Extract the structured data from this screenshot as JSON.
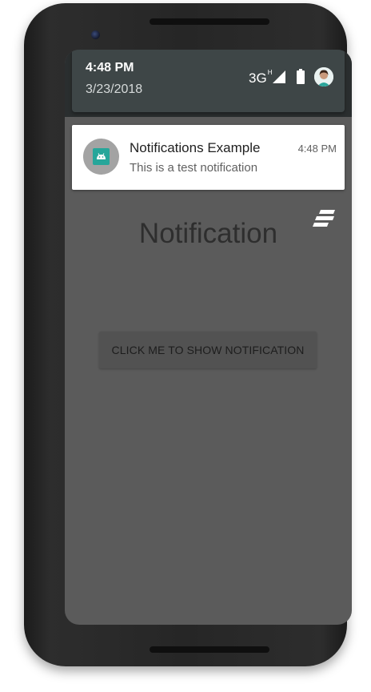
{
  "status_panel": {
    "time": "4:48 PM",
    "date": "3/23/2018",
    "network": "3G",
    "network_sub": "H",
    "icons": [
      "signal-icon",
      "battery-icon",
      "avatar"
    ]
  },
  "notification": {
    "title": "Notifications Example",
    "time": "4:48 PM",
    "text": "This is a test notification",
    "icon": "android-icon"
  },
  "app": {
    "title": "Notification",
    "button_label": "CLICK ME TO SHOW NOTIFICATION",
    "menu_icon": "stacked-bars-icon"
  },
  "colors": {
    "panel": "#3e4647",
    "screen_dim": "#5b5b5b",
    "notification_bg": "#ffffff",
    "android_green": "#26a69a"
  }
}
